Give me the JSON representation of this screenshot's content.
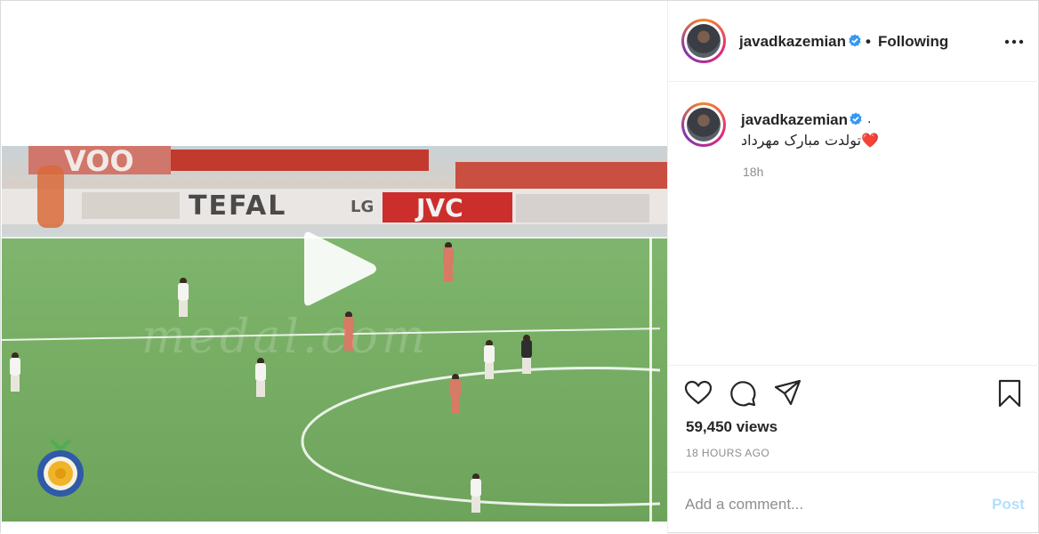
{
  "post": {
    "author": {
      "username": "javadkazemian",
      "verified": true
    },
    "header": {
      "separator": "•",
      "follow_label": "Following",
      "more_icon": "more-horizontal-icon"
    },
    "caption": {
      "username": "javadkazemian",
      "trailing_mark": ".",
      "text": "تولدت مبارک مهرداد",
      "emoji": "❤️",
      "time_ago": "18h"
    },
    "video": {
      "watermark": "medal.com",
      "play_icon": "play-icon",
      "ads": [
        "VOO",
        "TEFAL",
        "LG",
        "JVC"
      ]
    },
    "actions": {
      "like_icon": "heart-icon",
      "comment_icon": "comment-icon",
      "share_icon": "send-icon",
      "save_icon": "bookmark-icon"
    },
    "stats": {
      "views": "59,450 views",
      "timestamp": "18 HOURS AGO"
    },
    "comment_box": {
      "placeholder": "Add a comment...",
      "post_label": "Post"
    },
    "colors": {
      "verified_blue": "#3897f0",
      "post_button_disabled": "#b2dffc",
      "heart_red": "#e0243a"
    }
  }
}
